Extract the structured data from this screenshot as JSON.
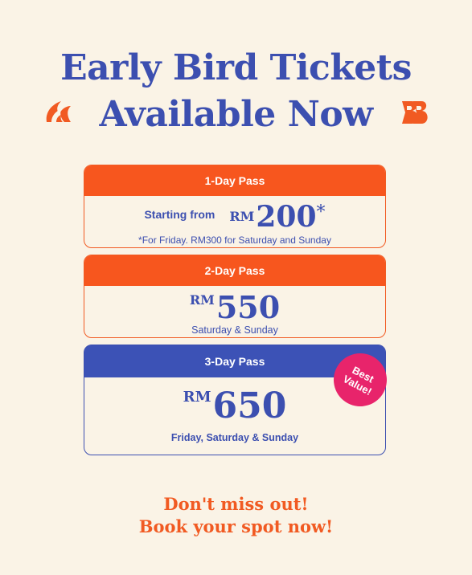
{
  "headline": {
    "line1": "Early Bird Tickets",
    "line2": "Available Now"
  },
  "decor": {
    "left": "orange-flame-icon",
    "right": "orange-bb-icon",
    "accent": "#f15a22",
    "primary": "#3c4fb0"
  },
  "passes": [
    {
      "title": "1-Day Pass",
      "prefix": "Starting from",
      "currency": "RM",
      "price": "200",
      "asterisk": "*",
      "note": "*For Friday. RM300 for Saturday and Sunday"
    },
    {
      "title": "2-Day Pass",
      "currency": "RM",
      "price": "550",
      "days": "Saturday & Sunday"
    },
    {
      "title": "3-Day Pass",
      "currency": "RM",
      "price": "650",
      "days": "Friday, Saturday & Sunday",
      "badge": {
        "line1": "Best",
        "line2": "Value!"
      }
    }
  ],
  "cta": {
    "line1": "Don't miss out!",
    "line2": "Book your spot now!"
  }
}
